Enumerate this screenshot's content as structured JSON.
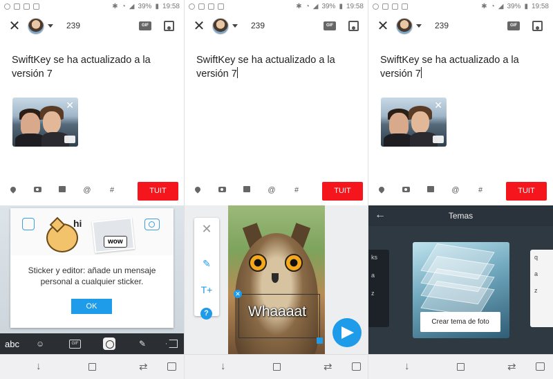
{
  "status": {
    "battery": "39%",
    "time": "19:58"
  },
  "compose": {
    "count": "239",
    "gif_label": "GIF",
    "text": "SwiftKey se ha actualizado a la versión 7",
    "tweet_button": "TUIT",
    "tools": {
      "mention": "@",
      "hashtag": "#"
    }
  },
  "panel1": {
    "dialog_message": "Sticker y editor: añade un mensaje personal a cualquier sticker.",
    "ok_button": "OK",
    "sticker_hi": "hi",
    "sticker_wow": "wow",
    "keyboard_abc": "abc",
    "keyboard_gif": "GIF"
  },
  "panel2": {
    "sticker_text": "Whaaaat",
    "text_tool": "T+",
    "help": "?"
  },
  "panel3": {
    "title": "Temas",
    "create_theme_button": "Crear tema de foto",
    "left_keys": [
      "ks",
      "a",
      "z"
    ],
    "right_keys": [
      "q",
      "a",
      "z"
    ]
  },
  "colors": {
    "accent_red": "#f5161d",
    "accent_blue": "#1e9be9"
  }
}
